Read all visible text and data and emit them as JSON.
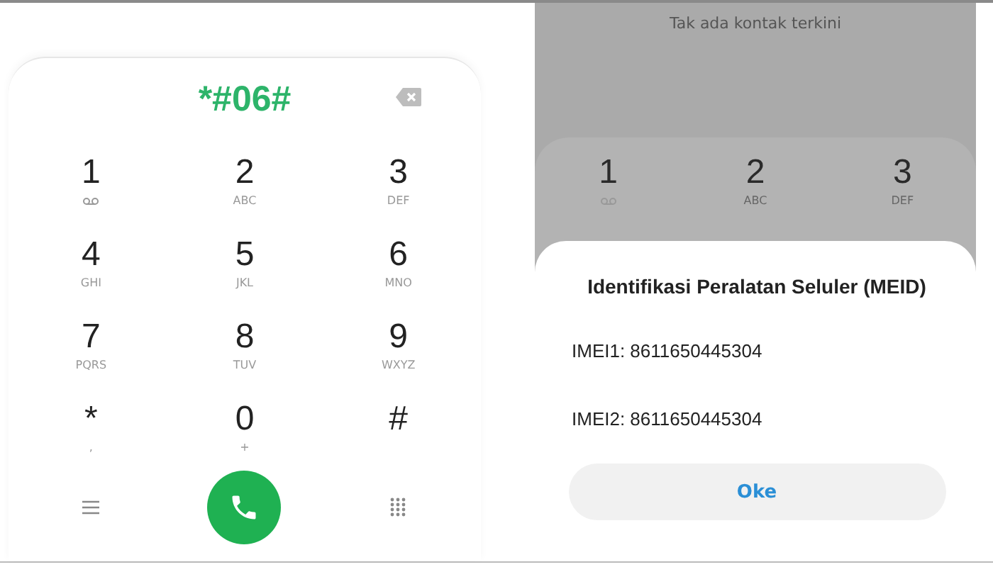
{
  "dialer": {
    "number": "*#06#",
    "keys": [
      {
        "digit": "1",
        "kind": "voicemail"
      },
      {
        "digit": "2",
        "kind": "letters",
        "letters": "ABC"
      },
      {
        "digit": "3",
        "kind": "letters",
        "letters": "DEF"
      },
      {
        "digit": "4",
        "kind": "letters",
        "letters": "GHI"
      },
      {
        "digit": "5",
        "kind": "letters",
        "letters": "JKL"
      },
      {
        "digit": "6",
        "kind": "letters",
        "letters": "MNO"
      },
      {
        "digit": "7",
        "kind": "letters",
        "letters": "PQRS"
      },
      {
        "digit": "8",
        "kind": "letters",
        "letters": "TUV"
      },
      {
        "digit": "9",
        "kind": "letters",
        "letters": "WXYZ"
      },
      {
        "digit": "*",
        "kind": "letters",
        "letters": ","
      },
      {
        "digit": "0",
        "kind": "letters",
        "letters": "+"
      },
      {
        "digit": "#",
        "kind": "blank"
      }
    ]
  },
  "result": {
    "recent_empty": "Tak ada kontak terkini",
    "keys": [
      {
        "digit": "1",
        "kind": "voicemail"
      },
      {
        "digit": "2",
        "kind": "letters",
        "letters": "ABC"
      },
      {
        "digit": "3",
        "kind": "letters",
        "letters": "DEF"
      }
    ],
    "dialog": {
      "title": "Identifikasi Peralatan Seluler (MEID)",
      "lines": [
        "IMEI1: 8611650445304",
        "IMEI2: 8611650445304"
      ],
      "button": "Oke"
    }
  }
}
